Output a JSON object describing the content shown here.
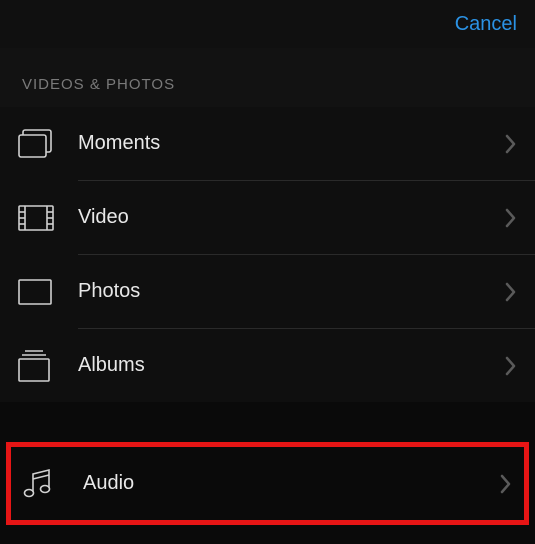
{
  "header": {
    "cancel_label": "Cancel"
  },
  "section": {
    "title": "VIDEOS & PHOTOS"
  },
  "items": [
    {
      "label": "Moments",
      "icon": "moments-icon"
    },
    {
      "label": "Video",
      "icon": "video-icon"
    },
    {
      "label": "Photos",
      "icon": "photos-icon"
    },
    {
      "label": "Albums",
      "icon": "albums-icon"
    }
  ],
  "audio": {
    "label": "Audio",
    "icon": "audio-icon"
  }
}
